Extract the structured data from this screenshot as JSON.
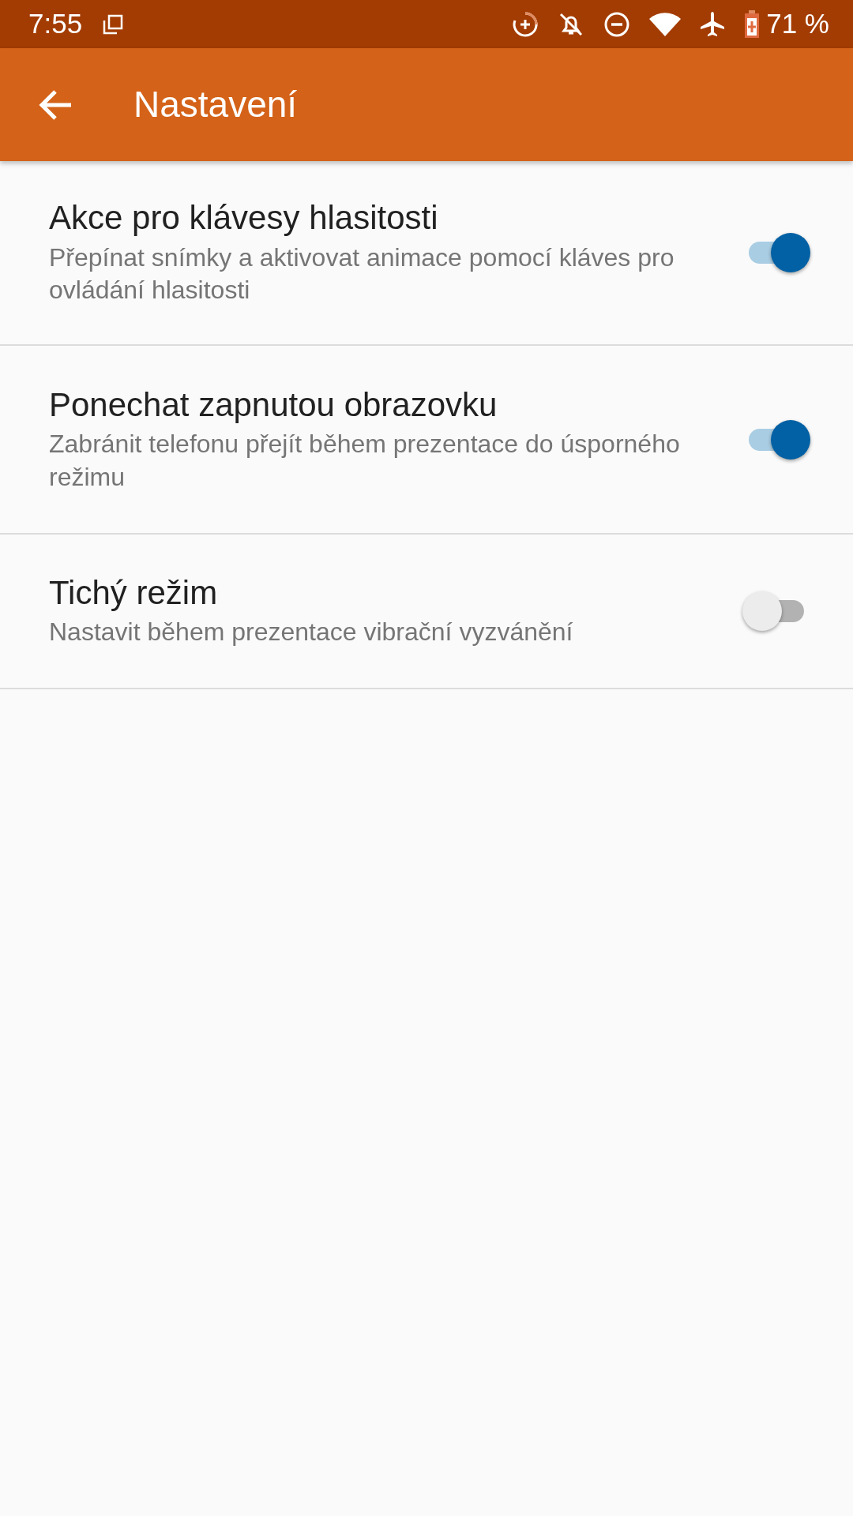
{
  "status_bar": {
    "time": "7:55",
    "battery": "71 %"
  },
  "app_bar": {
    "title": "Nastavení"
  },
  "settings": [
    {
      "title": "Akce pro klávesy hlasitosti",
      "summary": "Přepínat snímky a aktivovat animace pomocí kláves pro ovládání hlasitosti",
      "on": true
    },
    {
      "title": "Ponechat zapnutou obrazovku",
      "summary": "Zabránit telefonu přejít během prezentace do úsporného režimu",
      "on": true
    },
    {
      "title": "Tichý režim",
      "summary": "Nastavit během prezentace vibrační vyzvánění",
      "on": false
    }
  ]
}
